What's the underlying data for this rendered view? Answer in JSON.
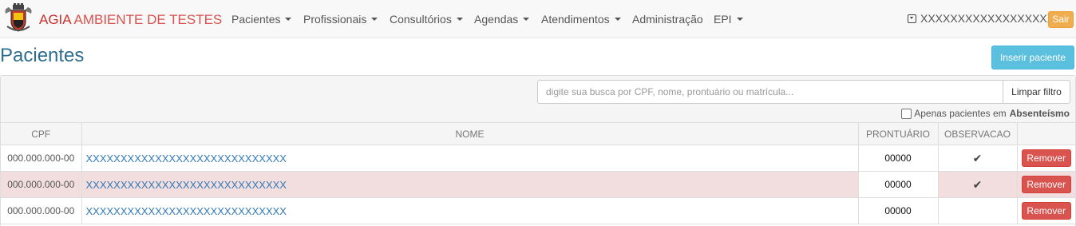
{
  "brand": {
    "part1": "AGIA ",
    "part2": "AMBIENTE DE TESTES",
    "logo_icon": "coat-of-arms-icon"
  },
  "nav": [
    {
      "label": "Pacientes",
      "dropdown": true
    },
    {
      "label": "Profissionais",
      "dropdown": true
    },
    {
      "label": "Consultórios",
      "dropdown": true
    },
    {
      "label": "Agendas",
      "dropdown": true
    },
    {
      "label": "Atendimentos",
      "dropdown": true
    },
    {
      "label": "Administração",
      "dropdown": false
    },
    {
      "label": "EPI",
      "dropdown": true
    }
  ],
  "user": {
    "name": "XXXXXXXXXXXXXXXXXX",
    "logout_label": "Sair"
  },
  "page": {
    "title": "Pacientes",
    "insert_label": "Inserir paciente"
  },
  "search": {
    "placeholder": "digite sua busca por CPF, nome, prontuário ou matrícula...",
    "clear_label": "Limpar filtro",
    "absent_label": "Apenas pacientes em",
    "absent_bold": "Absenteísmo"
  },
  "table": {
    "headers": {
      "cpf": "CPF",
      "nome": "NOME",
      "prontuario": "PRONTUÁRIO",
      "observacao": "OBSERVACAO"
    },
    "remove_label": "Remover",
    "rows": [
      {
        "cpf": "000.000.000-00",
        "nome": "XXXXXXXXXXXXXXXXXXXXXXXXXXXXX",
        "prontuario": "00000",
        "observacao": "✔"
      },
      {
        "cpf": "000.000.000-00",
        "nome": "XXXXXXXXXXXXXXXXXXXXXXXXXXXXX",
        "prontuario": "00000",
        "observacao": "✔"
      },
      {
        "cpf": "000.000.000-00",
        "nome": "XXXXXXXXXXXXXXXXXXXXXXXXXXXXX",
        "prontuario": "00000",
        "observacao": ""
      }
    ]
  },
  "colors": {
    "brand": "#c9302c",
    "title": "#2e6d8e",
    "link": "#337ab7",
    "danger": "#d9534f",
    "info": "#5bc0de",
    "warning": "#f0ad4e",
    "row_highlight": "#f2dede"
  }
}
